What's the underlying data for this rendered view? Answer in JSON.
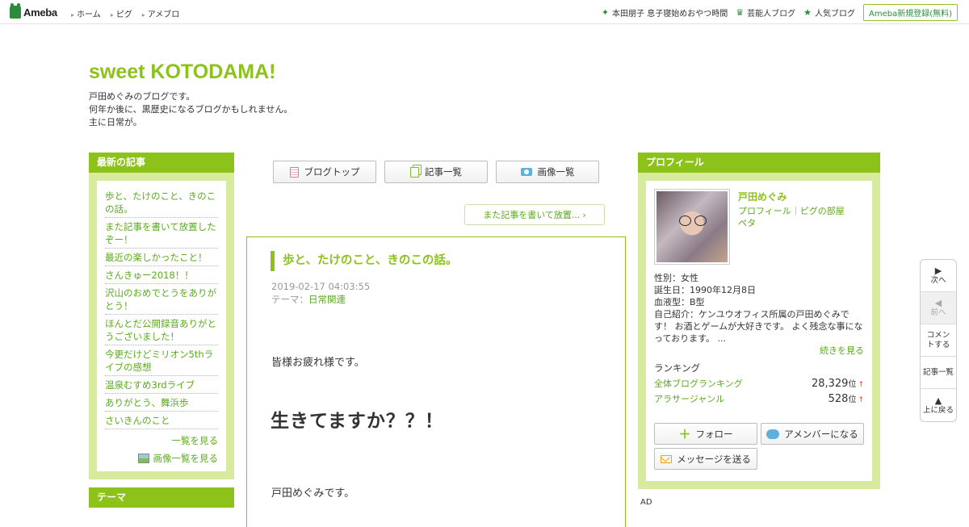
{
  "topbar": {
    "logo": "Ameba",
    "nav": [
      "ホーム",
      "ピグ",
      "アメブロ"
    ],
    "right_links": [
      {
        "icon": "sparkle-icon",
        "label": "本田朋子 息子寝始めおやつ時間"
      },
      {
        "icon": "crown-icon",
        "label": "芸能人ブログ"
      },
      {
        "icon": "star-icon",
        "label": "人気ブログ"
      }
    ],
    "register": "Ameba新規登録(無料)"
  },
  "blog": {
    "title": "sweet KOTODAMA!",
    "desc1": "戸田めぐみのブログです。",
    "desc2": "何年か後に、黒歴史になるブログかもしれません。",
    "desc3": "主に日常が。"
  },
  "left": {
    "recent_head": "最新の記事",
    "articles": [
      "歩と、たけのこと、きのこの話。",
      "また記事を書いて放置したぞー！",
      "最近の楽しかったこと！",
      "さんきゅー2018！！",
      "沢山のおめでとうをありがとう！",
      "ほんとだ公開録音ありがとうございました！",
      "今更だけどミリオン5thライブの感想",
      "温泉むすめ3rdライブ",
      "ありがとう、舞浜歩",
      "さいきんのこと"
    ],
    "see_all": "一覧を見る",
    "see_images": "画像一覧を見る",
    "theme_head": "テーマ"
  },
  "center": {
    "buttons": {
      "top": "ブログトップ",
      "list": "記事一覧",
      "images": "画像一覧"
    },
    "prev_link": "また記事を書いて放置...",
    "article": {
      "title": "歩と、たけのこと、きのこの話。",
      "date": "2019-02-17 04:03:55",
      "theme_label": "テーマ：",
      "theme": "日常関連",
      "p1": "皆様お疲れ様です。",
      "big": "生きてますか？？！",
      "p2": "戸田めぐみです。"
    }
  },
  "profile": {
    "head": "プロフィール",
    "name": "戸田めぐみ",
    "links": "プロフィール｜ピグの部屋",
    "peta": "ペタ",
    "gender": "性別：女性",
    "birthday": "誕生日：1990年12月8日",
    "blood": "血液型：B型",
    "intro": "自己紹介：ケンユウオフィス所属の戸田めぐみです！ お酒とゲームが大好きです。 よく残念な事になっております。 ...",
    "more": "続きを見る",
    "ranking_head": "ランキング",
    "rankings": [
      {
        "label": "全体ブログランキング",
        "value": "28,329",
        "unit": "位",
        "trend": "↑"
      },
      {
        "label": "アラサージャンル",
        "value": "528",
        "unit": "位",
        "trend": "↑"
      }
    ],
    "follow": "フォロー",
    "member": "アメンバーになる",
    "message": "メッセージを送る"
  },
  "ad": "AD",
  "floatnav": {
    "next": "次へ",
    "prev": "前へ",
    "comment": "コメントする",
    "list": "記事一覧",
    "top": "上に戻る"
  },
  "colors": {
    "accent": "#8cc21a",
    "side_bg": "#d7ea9d",
    "link": "#5aaa1e"
  }
}
